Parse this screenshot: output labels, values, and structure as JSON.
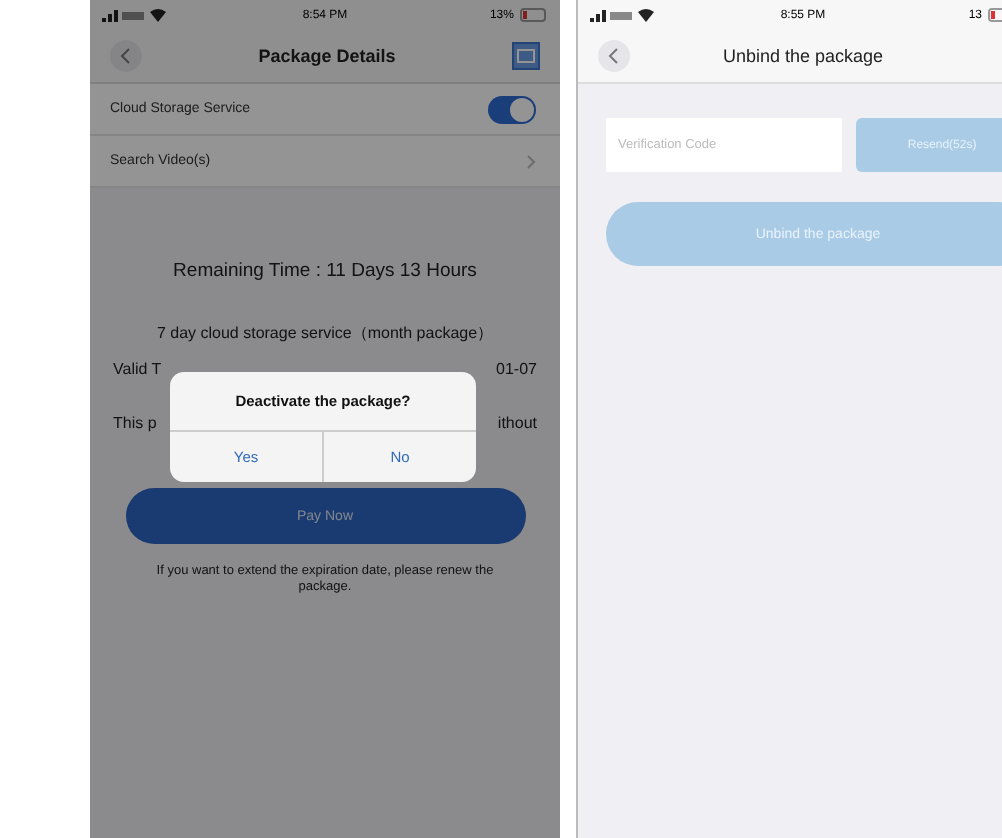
{
  "package_details": {
    "status_bar": {
      "time": "8:54 PM",
      "battery": "13%"
    },
    "title": "Package Details",
    "settings": [
      {
        "label": "Cloud Storage Service",
        "kind": "toggle",
        "on": true
      },
      {
        "label": "Search Video(s)",
        "kind": "link"
      }
    ],
    "remaining": "Remaining Time :  11 Days 13 Hours",
    "package_name": "7 day cloud storage service（month package）",
    "validity": {
      "left": "Valid T",
      "right": "01-07"
    },
    "note": {
      "left": "This p",
      "right": "ithout"
    },
    "pay_button": "Pay Now",
    "footnote": "If you want to extend the expiration date, please renew the package.",
    "dialog": {
      "title": "Deactivate the package?",
      "buttons": [
        "Yes",
        "No"
      ]
    }
  },
  "unbind": {
    "status_bar": {
      "time": "8:55 PM",
      "battery": "13"
    },
    "title": "Unbind the package",
    "code_field": {
      "placeholder": "Verification Code"
    },
    "resend_button": "Resend(52s)",
    "unbind_button": "Unbind the package"
  }
}
